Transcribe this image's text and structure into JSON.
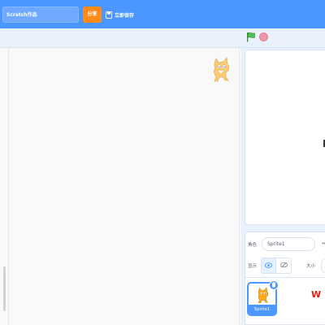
{
  "menu_bar": {
    "project_title": "Scratch作品",
    "share_label": "分享",
    "save_label": "立即保存",
    "accent_color": "#4c97ff",
    "share_color": "#ff8c1a",
    "save_icon": "floppy-disk-icon"
  },
  "stage_controls": {
    "green_flag_icon": "green-flag-icon",
    "stop_icon": "stop-sign-icon"
  },
  "sprite_info": {
    "sprite_label": "角色",
    "sprite_name": "Sprite1",
    "show_label": "显示",
    "size_label": "大小",
    "show_icon": "eye-icon",
    "hide_icon": "eye-slash-icon"
  },
  "sprite_list": {
    "items": [
      {
        "name": "Sprite1",
        "selected": true
      }
    ],
    "delete_icon": "trash-icon"
  },
  "watermark": {
    "text": "W"
  }
}
